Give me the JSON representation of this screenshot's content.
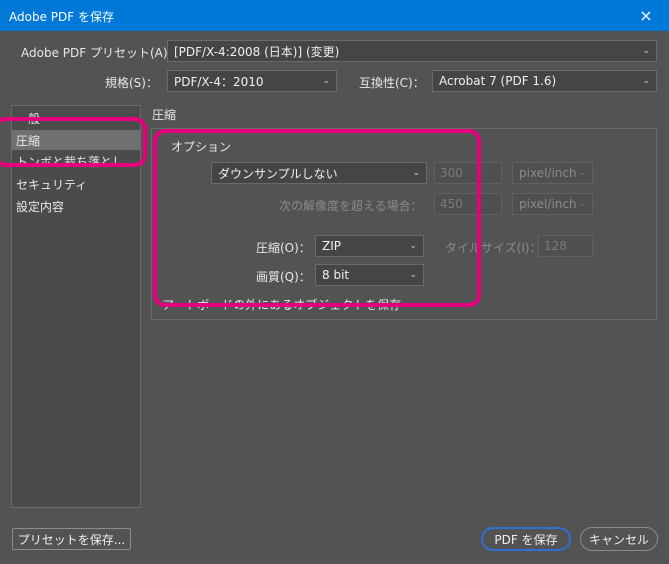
{
  "window": {
    "title": "Adobe PDF を保存",
    "close_icon": "×"
  },
  "top": {
    "preset_label": "Adobe PDF プリセット(A)：",
    "preset_value": "[PDF/X-4:2008 (日本)] (変更)",
    "standard_label": "規格(S)：",
    "standard_value": "PDF/X-4：2010",
    "compat_label": "互換性(C)：",
    "compat_value": "Acrobat 7 (PDF 1.6)"
  },
  "sidebar": {
    "items": [
      {
        "label": "一般"
      },
      {
        "label": "圧縮"
      },
      {
        "label": "トンボと裁ち落とし"
      },
      {
        "label": "セキュリティ"
      },
      {
        "label": "設定内容"
      }
    ]
  },
  "panel": {
    "title": "圧縮",
    "options_legend": "オプション",
    "downsample_value": "ダウンサンプルしない",
    "ppi_value": "300",
    "ppi_unit": "pixel/inch",
    "above_label": "次の解像度を超える場合：",
    "above_value": "450",
    "above_unit": "pixel/inch",
    "compression_label": "圧縮(O)：",
    "compression_value": "ZIP",
    "tile_label": "タイルサイズ(I)：",
    "tile_value": "128",
    "quality_label": "画質(Q)：",
    "quality_value": "8 bit",
    "partial_row": "アートボードの外にあるオブジェクトを保存"
  },
  "footer": {
    "save_preset": "プリセットを保存...",
    "save_pdf": "PDF を保存",
    "cancel": "キャンセル"
  }
}
